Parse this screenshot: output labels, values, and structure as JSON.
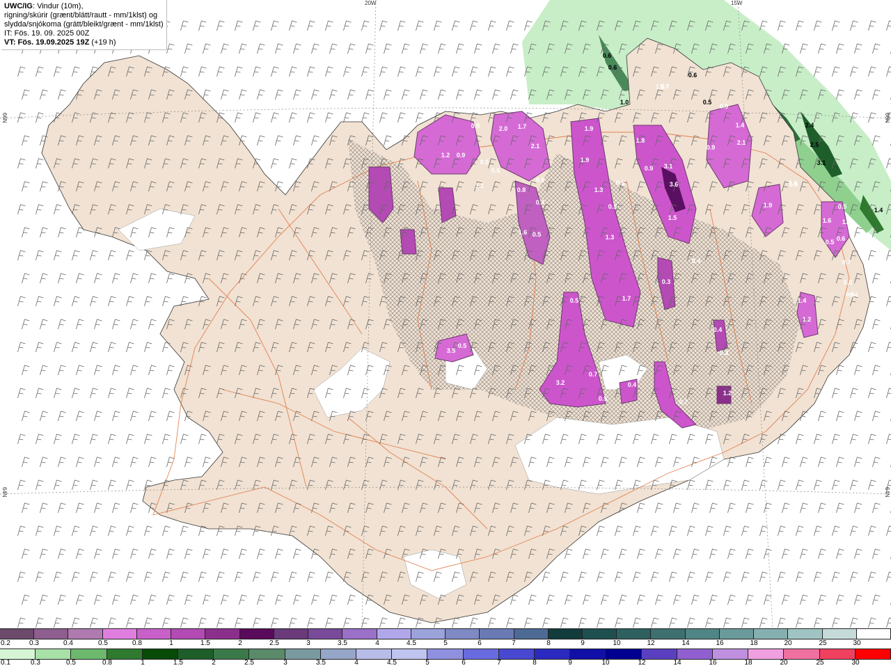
{
  "title": {
    "model": "UWC/IG",
    "line1": ": Vindur (10m),",
    "line2": "rigning/skúrir (grænt/blátt/rautt - mm/1klst) og",
    "line3": "slydda/snjókoma (grátt/bleikt/grænt - mm/1klst)",
    "it": "IT: Fös. 19. 09. 2025 00Z",
    "vt": "VT: Fös. 19.09.2025 19Z",
    "vt_offset": " (+19 h)"
  },
  "grid_labels": {
    "lon_20w": "20W",
    "lon_15w": "15W",
    "lat_66n_left": "66N",
    "lat_66n_right": "66N",
    "lat_64n_left": "64N",
    "lat_64n_right": "64N"
  },
  "colorbar_snow": {
    "labels": [
      "0.2",
      "0.3",
      "0.4",
      "0.5",
      "0.8",
      "1",
      "1.5",
      "2",
      "2.5",
      "3",
      "3.5",
      "4",
      "4.5",
      "5",
      "6",
      "7",
      "8",
      "9",
      "10",
      "12",
      "14",
      "16",
      "18",
      "20",
      "25",
      "30"
    ],
    "colors": [
      "#6b4a6b",
      "#8e5e8e",
      "#b07ab0",
      "#e07ee0",
      "#c95fc9",
      "#b44ab4",
      "#8c2f8c",
      "#5a0a5a",
      "#6a3a7a",
      "#7a4a9a",
      "#9a70c8",
      "#b0a8ea",
      "#9ca2da",
      "#7f8ac5",
      "#6a7ab5",
      "#4d6a95",
      "#123c3c",
      "#1e5050",
      "#2e6060",
      "#3e7070",
      "#508585",
      "#6a9a9a",
      "#86b0b0",
      "#a0c4c4",
      "#c6dada",
      "#ffffff"
    ]
  },
  "colorbar_rain": {
    "labels": [
      "0.1",
      "0.3",
      "0.5",
      "0.8",
      "1",
      "1.5",
      "2",
      "2.5",
      "3",
      "3.5",
      "4",
      "4.5",
      "5",
      "6",
      "7",
      "8",
      "9",
      "10",
      "12",
      "14",
      "16",
      "18",
      "20",
      "25",
      "30"
    ],
    "colors": [
      "#d6f5d6",
      "#a8e0a8",
      "#6cb86c",
      "#2f7a2f",
      "#084a08",
      "#1e5e2a",
      "#3a7a4a",
      "#5a8a6a",
      "#7a9aa0",
      "#96a6c8",
      "#b8bce8",
      "#c0c4f0",
      "#9090e0",
      "#6a6ae0",
      "#4848d0",
      "#2a2ac0",
      "#1010a8",
      "#000090",
      "#5a40c0",
      "#9060d0",
      "#c090e0",
      "#f0a0e0",
      "#f070a0",
      "#f04060",
      "#ff0000"
    ]
  },
  "precip_labels": [
    {
      "t": "0.6",
      "c": "k"
    },
    {
      "t": "0.6",
      "c": "k"
    },
    {
      "t": "0.6",
      "c": "k"
    },
    {
      "t": "0.5",
      "c": "k"
    },
    {
      "t": "1.0",
      "c": "k"
    },
    {
      "t": "0.9",
      "c": "w"
    },
    {
      "t": "1.4",
      "c": "w"
    },
    {
      "t": "2.1",
      "c": "w"
    },
    {
      "t": "2.4",
      "c": "k"
    },
    {
      "t": "2.5",
      "c": "k"
    },
    {
      "t": "3.1",
      "c": "k"
    },
    {
      "t": "1.4",
      "c": "k"
    },
    {
      "t": "0.9",
      "c": "w"
    },
    {
      "t": "1.5",
      "c": "w"
    },
    {
      "t": "1.2",
      "c": "w"
    },
    {
      "t": "0.9",
      "c": "w"
    },
    {
      "t": "2.0",
      "c": "w"
    },
    {
      "t": "1.7",
      "c": "w"
    },
    {
      "t": "2.1",
      "c": "w"
    },
    {
      "t": "1.9",
      "c": "w"
    },
    {
      "t": "1.8",
      "c": "w"
    },
    {
      "t": "3.1",
      "c": "w"
    },
    {
      "t": "3.6",
      "c": "w"
    },
    {
      "t": "1.9",
      "c": "w"
    },
    {
      "t": "0.9",
      "c": "w"
    },
    {
      "t": "1.3",
      "c": "w"
    },
    {
      "t": "0.5",
      "c": "w"
    },
    {
      "t": "1.5",
      "c": "w"
    },
    {
      "t": "1.3",
      "c": "w"
    },
    {
      "t": "1.7",
      "c": "w"
    },
    {
      "t": "0.5",
      "c": "w"
    },
    {
      "t": "0.4",
      "c": "w"
    },
    {
      "t": "0.3",
      "c": "w"
    },
    {
      "t": "1.9",
      "c": "w"
    },
    {
      "t": "1.6",
      "c": "w"
    },
    {
      "t": "1.2",
      "c": "w"
    },
    {
      "t": "0.6",
      "c": "w"
    },
    {
      "t": "0.5",
      "c": "w"
    },
    {
      "t": "3.2",
      "c": "w"
    },
    {
      "t": "0.7",
      "c": "w"
    },
    {
      "t": "0.5",
      "c": "w"
    },
    {
      "t": "0.4",
      "c": "w"
    },
    {
      "t": "0.7",
      "c": "w"
    },
    {
      "t": "0.5",
      "c": "w"
    },
    {
      "t": "3.5",
      "c": "w"
    },
    {
      "t": "0.9",
      "c": "w"
    },
    {
      "t": "1.1",
      "c": "w"
    },
    {
      "t": "0.5",
      "c": "w"
    },
    {
      "t": "0.6",
      "c": "w"
    },
    {
      "t": "0.5",
      "c": "w"
    },
    {
      "t": "1.6",
      "c": "w"
    },
    {
      "t": "0.8",
      "c": "w"
    },
    {
      "t": "0.5",
      "c": "w"
    },
    {
      "t": "0.4",
      "c": "w"
    },
    {
      "t": "0.5",
      "c": "w"
    },
    {
      "t": "0.4",
      "c": "w"
    },
    {
      "t": "1.4",
      "c": "w"
    },
    {
      "t": "1.2",
      "c": "w"
    },
    {
      "t": "0.4",
      "c": "w"
    },
    {
      "t": "0.5",
      "c": "w"
    },
    {
      "t": "1.6",
      "c": "w"
    },
    {
      "t": "0.9",
      "c": "w"
    },
    {
      "t": "0.7",
      "c": "w"
    },
    {
      "t": "0.6",
      "c": "w"
    },
    {
      "t": "1.0",
      "c": "w"
    },
    {
      "t": "1.2",
      "c": "w"
    },
    {
      "t": "0.8",
      "c": "w"
    },
    {
      "t": "0.4",
      "c": "w"
    },
    {
      "t": "0.3",
      "c": "w"
    }
  ]
}
